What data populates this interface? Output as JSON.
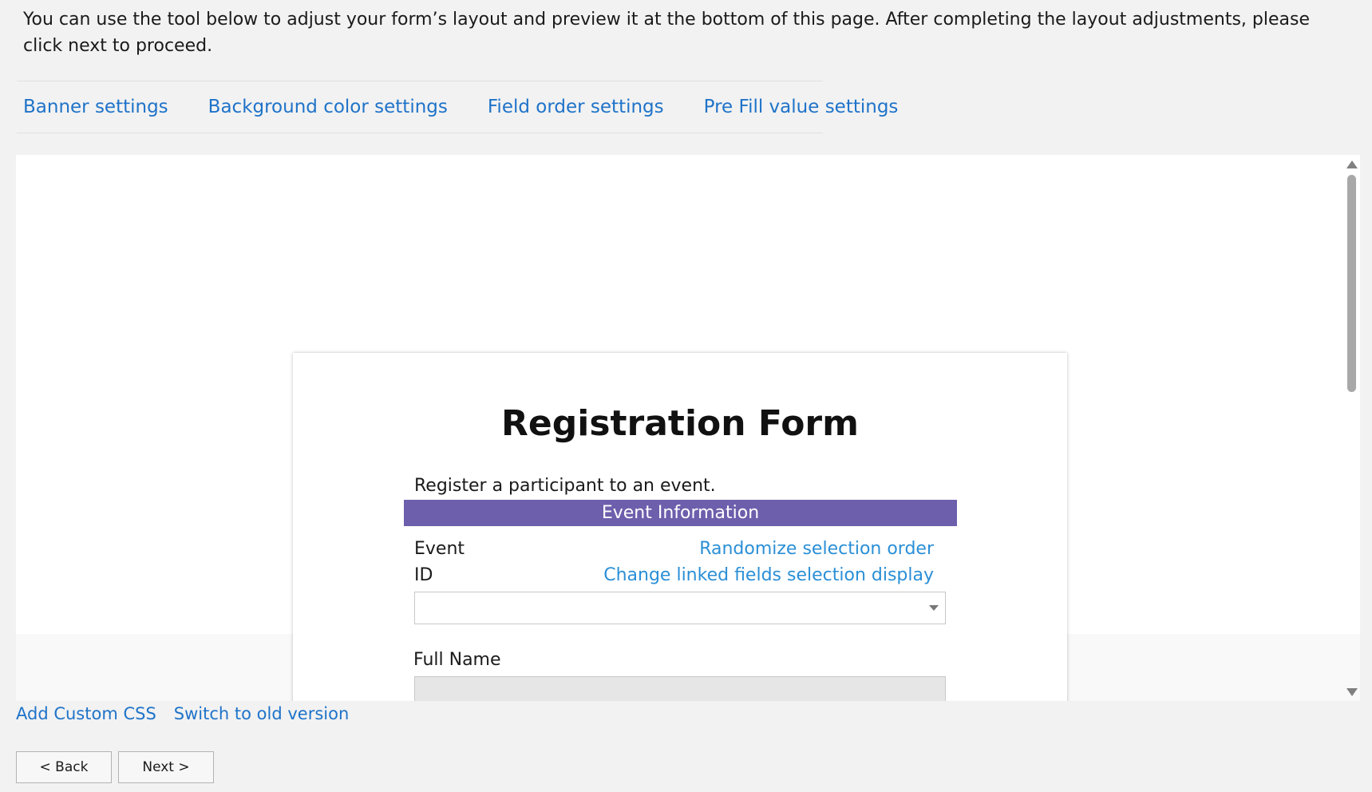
{
  "intro_text": "You can use the tool below to adjust your form’s layout and preview it at the bottom of this page. After completing the layout adjustments, please click next to proceed.",
  "tabs": [
    {
      "label": "Banner settings"
    },
    {
      "label": "Background color settings"
    },
    {
      "label": "Field order settings"
    },
    {
      "label": "Pre Fill value settings"
    }
  ],
  "form": {
    "title": "Registration Form",
    "description": "Register a participant to an event.",
    "section_title": "Event Information",
    "section_color": "#6d5fac",
    "event_label": "Event",
    "id_label": "ID",
    "randomize_link": "Randomize selection order",
    "linked_fields_link": "Change linked fields selection display",
    "event_select_value": "",
    "full_name_label": "Full Name",
    "full_name_value": ""
  },
  "bottom_links": {
    "custom_css": "Add Custom CSS",
    "old_version": "Switch to old version"
  },
  "buttons": {
    "back": "< Back",
    "next": "Next >"
  },
  "colors": {
    "link": "#1f73c9",
    "form_link": "#2b8fd6",
    "page_bg": "#f2f2f2"
  }
}
